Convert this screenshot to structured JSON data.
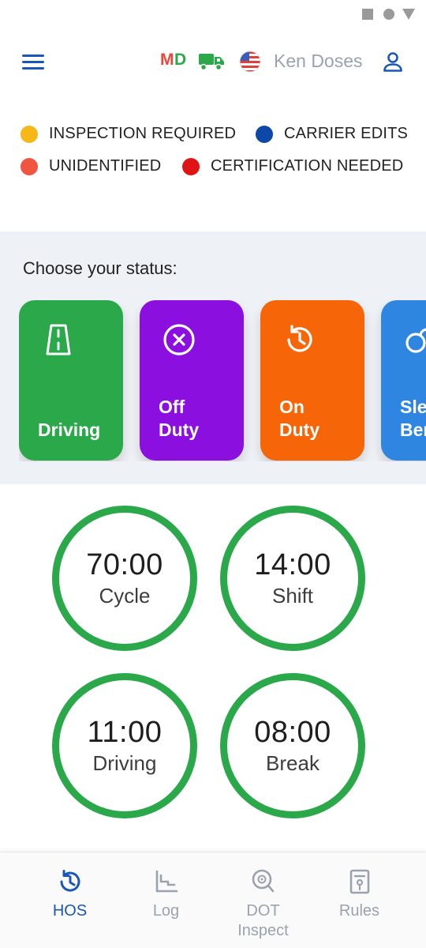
{
  "header": {
    "state_code_first": "M",
    "state_code_second": "D",
    "driver_name": "Ken Doses",
    "icons": [
      "menu-icon",
      "truck-icon",
      "us-flag-icon",
      "person-icon"
    ]
  },
  "legend": {
    "items": [
      {
        "label": "INSPECTION REQUIRED",
        "color": "#f5b817"
      },
      {
        "label": "CARRIER EDITS",
        "color": "#0d47a8"
      },
      {
        "label": "UNIDENTIFIED",
        "color": "#f0553f"
      },
      {
        "label": "CERTIFICATION NEEDED",
        "color": "#e01414"
      }
    ]
  },
  "status": {
    "prompt": "Choose your status:",
    "options": [
      {
        "label": "Driving",
        "color": "#2aa84a",
        "icon": "road-icon"
      },
      {
        "label": "Off\nDuty",
        "color": "#8b10e0",
        "icon": "circle-x-icon"
      },
      {
        "label": "On\nDuty",
        "color": "#f66507",
        "icon": "clock-history-icon"
      },
      {
        "label": "Sleeper\nBerth",
        "color": "#2f86e0",
        "icon": "sleeper-icon"
      }
    ]
  },
  "clocks": [
    {
      "time": "70:00",
      "label": "Cycle"
    },
    {
      "time": "14:00",
      "label": "Shift"
    },
    {
      "time": "11:00",
      "label": "Driving"
    },
    {
      "time": "08:00",
      "label": "Break"
    }
  ],
  "clock_ring_color": "#2aa84a",
  "nav": {
    "items": [
      {
        "label": "HOS",
        "icon": "hos-clock-icon",
        "active": true
      },
      {
        "label": "Log",
        "icon": "log-chart-icon",
        "active": false
      },
      {
        "label": "DOT\nInspect",
        "icon": "dot-inspect-icon",
        "active": false
      },
      {
        "label": "Rules",
        "icon": "rules-document-icon",
        "active": false
      }
    ],
    "active_color": "#1a56b8",
    "inactive_color": "#9aa3ad"
  }
}
